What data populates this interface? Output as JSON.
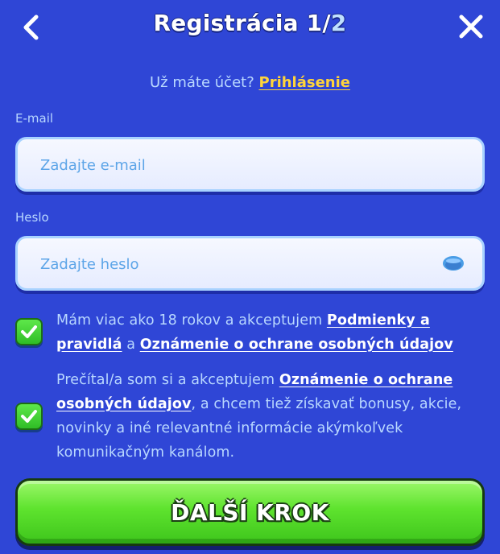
{
  "header": {
    "title_main": "Registrácia 1/",
    "title_total": "2",
    "back_icon": "chevron-left-icon",
    "close_icon": "close-icon"
  },
  "login_prompt": {
    "text": "Už máte účet?",
    "link_label": "Prihlásenie"
  },
  "email": {
    "label": "E-mail",
    "placeholder": "Zadajte e-mail",
    "value": ""
  },
  "password": {
    "label": "Heslo",
    "placeholder": "Zadajte heslo",
    "value": "",
    "toggle_icon": "eye-icon"
  },
  "consents": [
    {
      "checked": true,
      "text_before": "Mám viac ako 18 rokov a akceptujem",
      "link1": "Podmienky a pravidlá",
      "text_mid": "a",
      "link2": "Oznámenie o ochrane osobných údajov"
    },
    {
      "checked": true,
      "text_before": "Prečítal/a som si a akceptujem",
      "link1": "Oznámenie o ochrane osobných údajov",
      "text_after": ", a chcem tiež získavať bonusy, akcie, novinky a iné relevantné informácie akýmkoľvek komunikačným kanálom."
    }
  ],
  "next_button": {
    "label": "ĎALŠÍ KROK"
  },
  "colors": {
    "background": "#2f46d6",
    "accent_link": "#ffd43a",
    "muted_text": "#b9d8ff",
    "button_green": "#5ee32e",
    "checkbox_green": "#3fcf2f"
  }
}
